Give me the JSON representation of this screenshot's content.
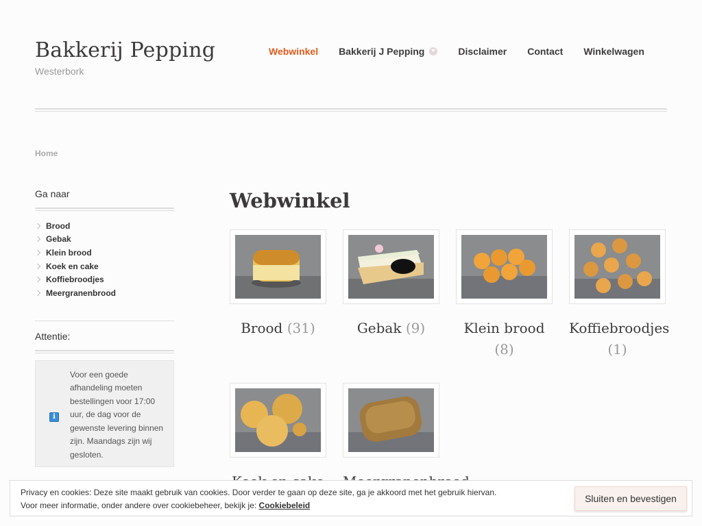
{
  "site": {
    "title": "Bakkerij Pepping",
    "tagline": "Westerbork"
  },
  "nav": [
    {
      "label": "Webwinkel",
      "active": true
    },
    {
      "label": "Bakkerij J Pepping",
      "dropdown": true
    },
    {
      "label": "Disclaimer"
    },
    {
      "label": "Contact"
    },
    {
      "label": "Winkelwagen"
    }
  ],
  "breadcrumb": "Home",
  "sidebar": {
    "goto_title": "Ga naar",
    "categories": [
      "Brood",
      "Gebak",
      "Klein brood",
      "Koek en cake",
      "Koffiebroodjes",
      "Meergranenbrood"
    ],
    "attention_title": "Attentie:",
    "notice": "Voor een goede afhandeling moeten bestellingen voor 17:00 uur, de dag voor de gewenste levering binnen zijn. Maandags zijn wij gesloten."
  },
  "main": {
    "title": "Webwinkel",
    "products": [
      {
        "name": "Brood",
        "count": "(31)",
        "icon": "bread-photo"
      },
      {
        "name": "Gebak",
        "count": "(9)",
        "icon": "cake-photo"
      },
      {
        "name": "Klein brood",
        "count": "(8)",
        "icon": "rolls-photo"
      },
      {
        "name": "Koffiebroodjes",
        "count": "(1)",
        "icon": "pastry-photo"
      },
      {
        "name": "Koek en cake",
        "count": "",
        "icon": "cookie-photo"
      },
      {
        "name": "Meergranenbrood",
        "count": "",
        "icon": "multigrain-photo"
      }
    ]
  },
  "cookie": {
    "line1": "Privacy en cookies: Deze site maakt gebruik van cookies. Door verder te gaan op deze site, ga je akkoord met het gebruik hiervan.",
    "line2": "Voor meer informatie, onder andere over cookiebeheer, bekijk je:",
    "link": "Cookiebeleid",
    "button": "Sluiten en bevestigen"
  },
  "colors": {
    "accent": "#e55a1c",
    "text": "#3d3a3a"
  }
}
